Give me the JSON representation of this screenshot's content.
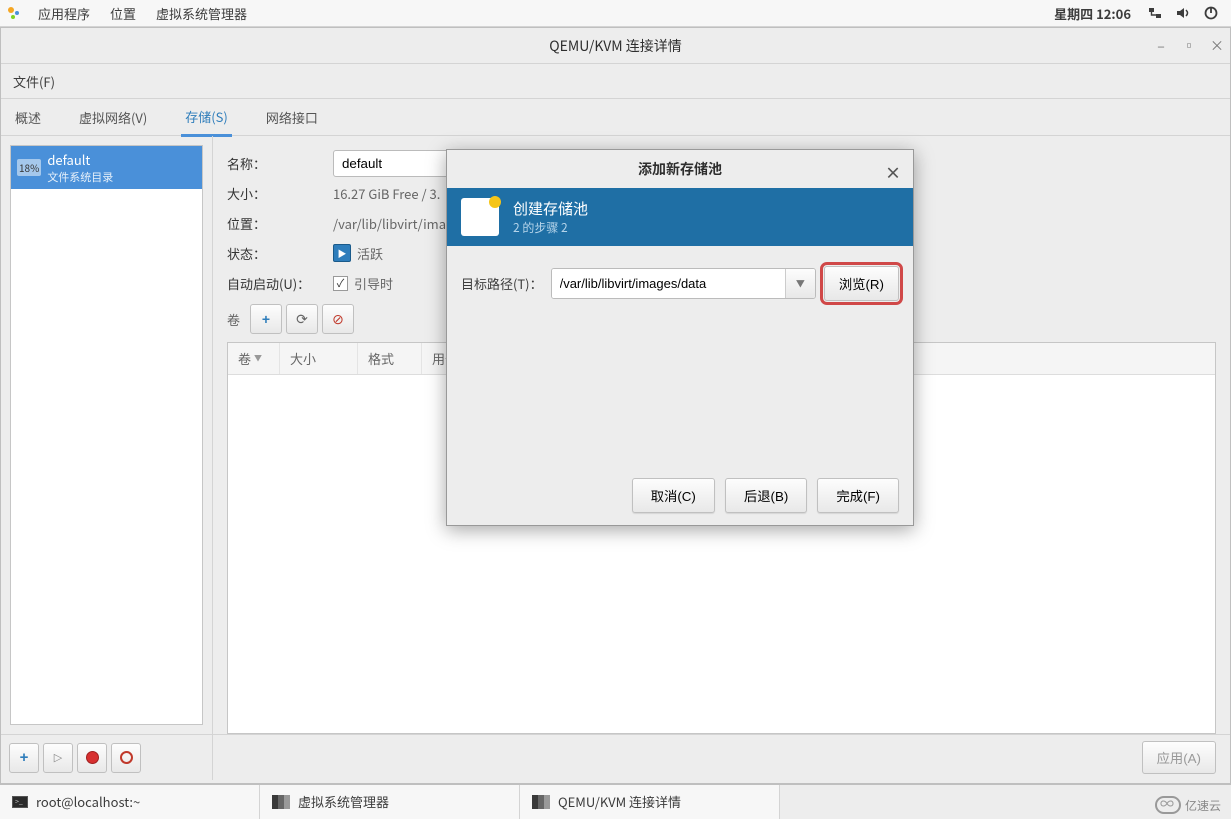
{
  "top_panel": {
    "menu_apps": "应用程序",
    "menu_places": "位置",
    "menu_vmm": "虚拟系统管理器",
    "clock": "星期四 12:06"
  },
  "window": {
    "title": "QEMU/KVM 连接详情",
    "menu_file": "文件(F)"
  },
  "tabs": {
    "overview": "概述",
    "virtual_net": "虚拟网络(V)",
    "storage": "存储(S)",
    "net_iface": "网络接口"
  },
  "pool": {
    "percent": "18%",
    "name": "default",
    "subtitle": "文件系统目录"
  },
  "details": {
    "label_name": "名称：",
    "value_name": "default",
    "label_size": "大小：",
    "value_size": "16.27 GiB Free / 3.",
    "label_location": "位置：",
    "value_location": "/var/lib/libvirt/image",
    "label_state": "状态：",
    "value_state": "活跃",
    "label_autostart": "自动启动(U)：",
    "value_autostart": "引导时",
    "label_volumes": "卷"
  },
  "vol_columns": {
    "c1": "卷",
    "c2": "大小",
    "c3": "格式",
    "c4": "用于"
  },
  "apply_label": "应用(A)",
  "modal": {
    "title": "添加新存储池",
    "heading": "创建存储池",
    "step": "2 的步骤 2",
    "target_path_label": "目标路径(T)：",
    "target_path_value": "/var/lib/libvirt/images/data",
    "browse": "浏览(R)",
    "cancel": "取消(C)",
    "back": "后退(B)",
    "finish": "完成(F)"
  },
  "taskbar": {
    "terminal": "root@localhost:~",
    "vmm": "虚拟系统管理器",
    "conn_details": "QEMU/KVM 连接详情",
    "watermark": "亿速云"
  }
}
